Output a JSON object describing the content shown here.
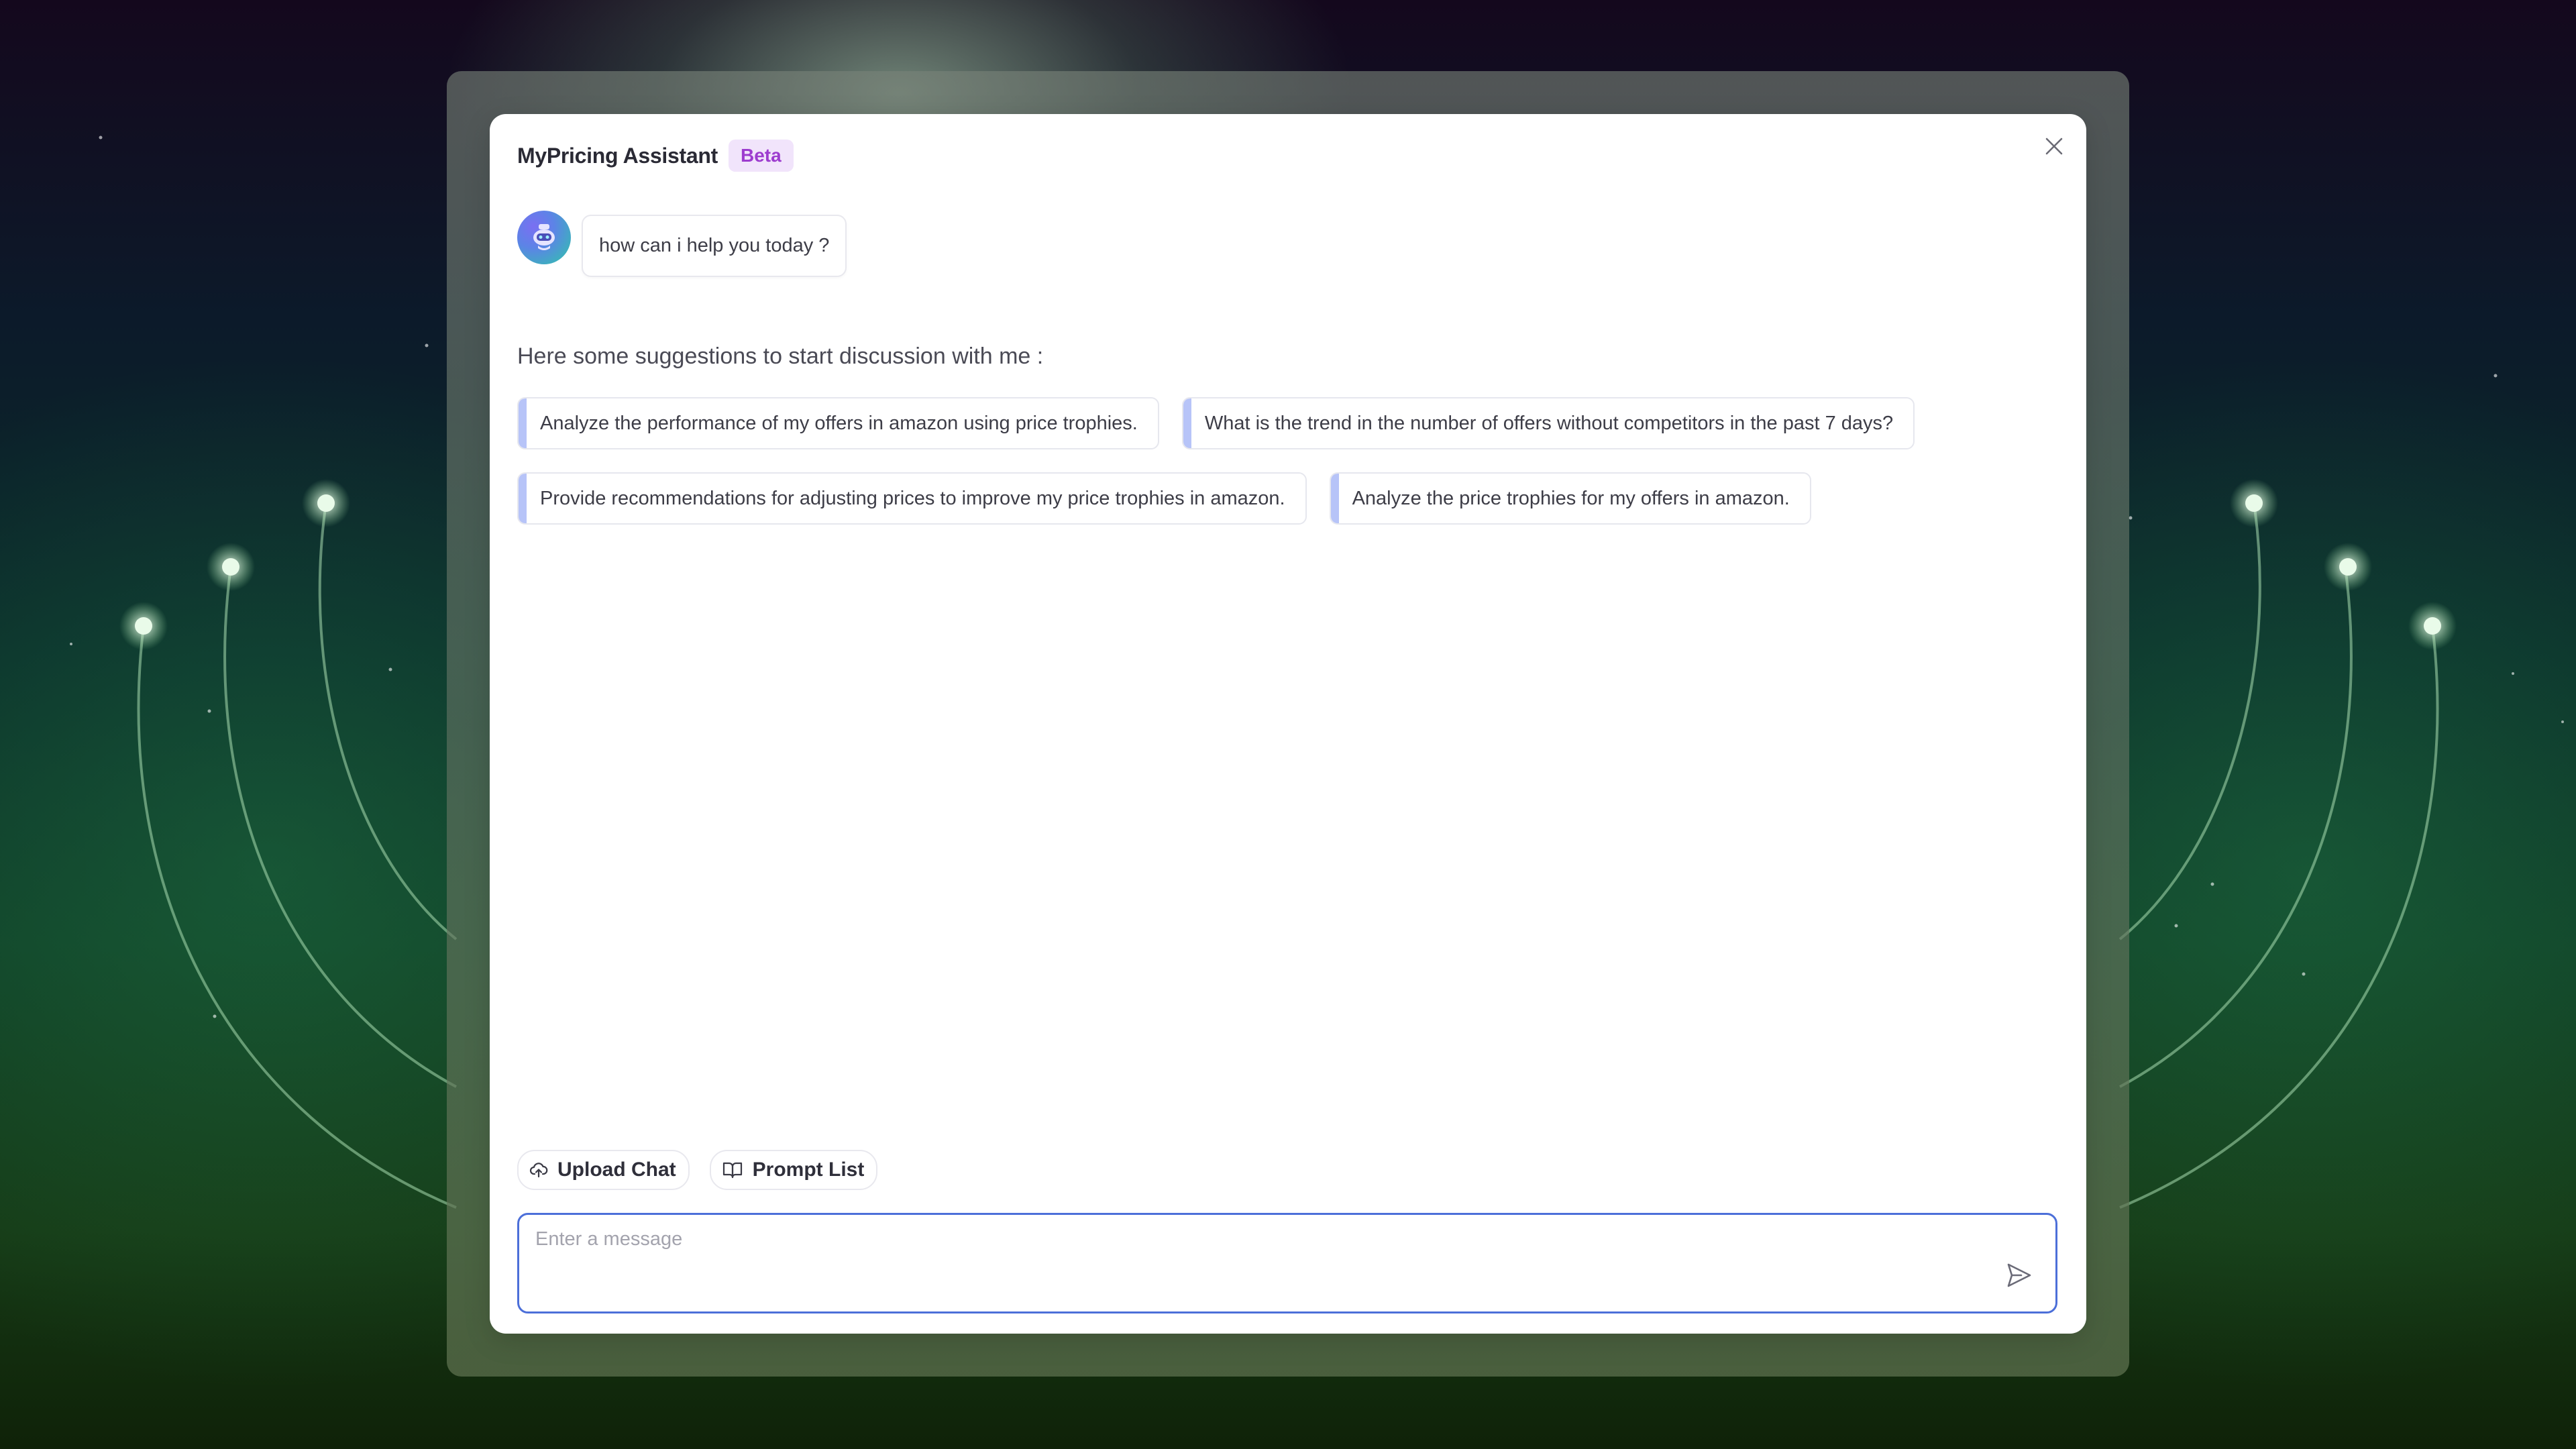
{
  "dialog": {
    "title": "MyPricing Assistant",
    "badge": "Beta",
    "close_icon": "close-icon"
  },
  "chat": {
    "messages": [
      {
        "sender": "assistant",
        "avatar_icon": "robot-icon",
        "text": "how can i help you today ?"
      }
    ]
  },
  "suggestions": {
    "heading": "Here some suggestions to start discussion with me :",
    "items": [
      "Analyze the performance of my offers in amazon using price trophies.",
      "What is the trend in the number of offers without competitors in the past 7 days?",
      "Provide recommendations for adjusting prices to improve my price trophies in amazon.",
      "Analyze the price trophies for my offers in amazon."
    ]
  },
  "actions": {
    "upload_chat": {
      "label": "Upload Chat",
      "icon": "cloud-upload-icon"
    },
    "prompt_list": {
      "label": "Prompt List",
      "icon": "book-icon"
    }
  },
  "composer": {
    "value": "",
    "placeholder": "Enter a message",
    "send_icon": "send-icon"
  },
  "colors": {
    "accent": "#4c6fd9",
    "badge_bg": "#f1e4fb",
    "badge_text": "#9d3ccf",
    "chip_accent": "#b7c4f8"
  }
}
